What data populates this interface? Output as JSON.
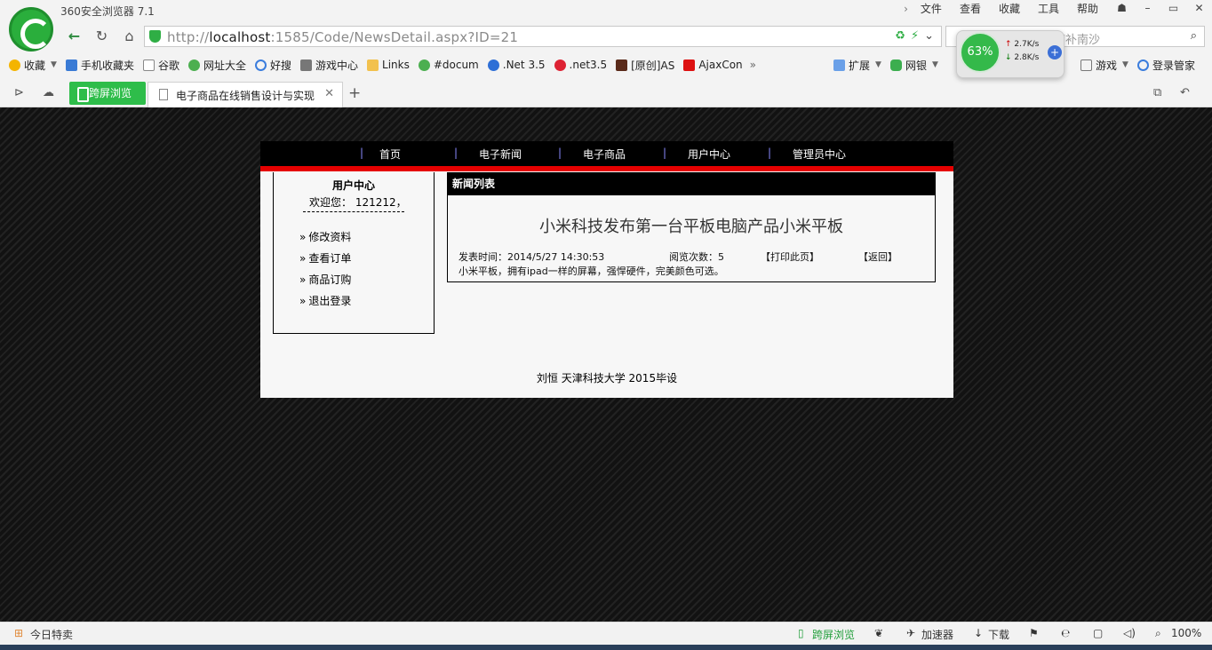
{
  "browser": {
    "app_title": "360安全浏览器 7.1",
    "menu": [
      "文件",
      "查看",
      "收藏",
      "工具",
      "帮助"
    ],
    "url_prefix": "http://",
    "url_host": "localhost",
    "url_rest": ":1585/Code/NewsDetail.aspx?ID=21",
    "search_placeholder": "…至香型土腐补南沙",
    "speed": {
      "percent": "63%",
      "up": "2.7K/s",
      "down": "2.8K/s"
    },
    "bookmarks": [
      "收藏",
      "手机收藏夹",
      "谷歌",
      "网址大全",
      "好搜",
      "游戏中心",
      "Links",
      "#docum",
      ".Net 3.5",
      ".net3.5",
      "[原创]AS",
      "AjaxCon"
    ],
    "bookmarks_right": [
      "扩展",
      "网银",
      "游戏",
      "登录管家"
    ],
    "crossscreen_label": "跨屏浏览",
    "tab_title": "电子商品在线销售设计与实现",
    "status": {
      "today": "今日特卖",
      "crossscreen": "跨屏浏览",
      "accelerator": "加速器",
      "download": "下载",
      "zoom": "100%"
    }
  },
  "site": {
    "nav": [
      "首页",
      "电子新闻",
      "电子商品",
      "用户中心",
      "管理员中心"
    ],
    "sidebar": {
      "title": "用户中心",
      "welcome": "欢迎您： 121212，",
      "items": [
        "修改资料",
        "查看订单",
        "商品订购",
        "退出登录"
      ]
    },
    "news": {
      "header": "新闻列表",
      "title": "小米科技发布第一台平板电脑产品小米平板",
      "published": "发表时间：2014/5/27 14:30:53",
      "views": "阅览次数：5",
      "print": "【打印此页】",
      "back": "【返回】",
      "content": "小米平板，拥有ipad一样的屏幕，强悍硬件，完美颜色可选。"
    },
    "footer": "刘恒 天津科技大学 2015毕设"
  }
}
